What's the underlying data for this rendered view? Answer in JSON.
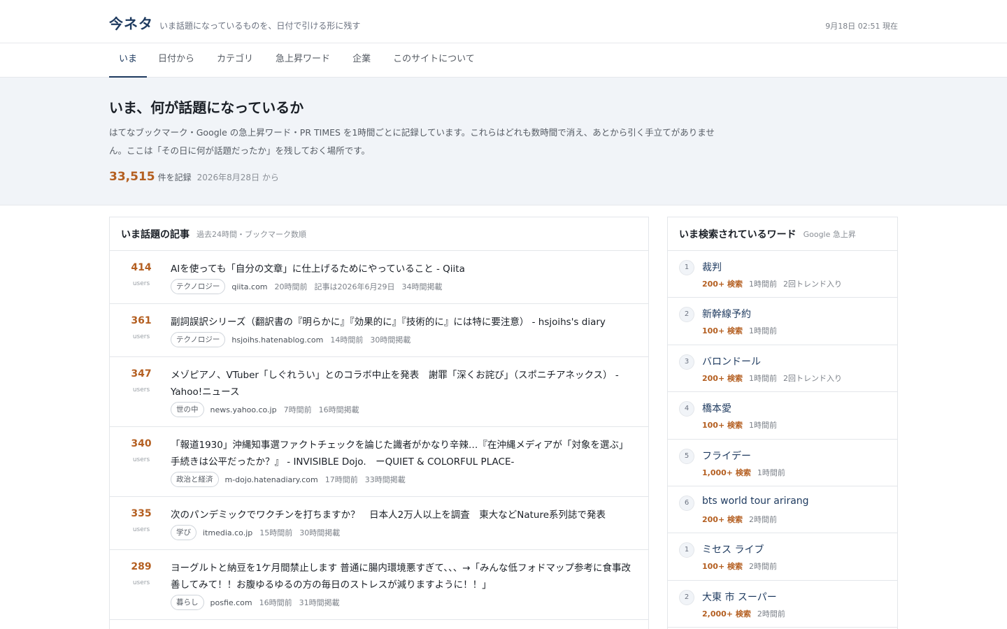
{
  "header": {
    "brand": "今ネタ",
    "tagline": "いま話題になっているものを、日付で引ける形に残す",
    "now": "9月18日 02:51 現在"
  },
  "nav": [
    {
      "label": "いま",
      "active": true
    },
    {
      "label": "日付から",
      "active": false
    },
    {
      "label": "カテゴリ",
      "active": false
    },
    {
      "label": "急上昇ワード",
      "active": false
    },
    {
      "label": "企業",
      "active": false
    },
    {
      "label": "このサイトについて",
      "active": false
    }
  ],
  "hero": {
    "title": "いま、何が話題になっているか",
    "description": "はてなブックマーク・Google の急上昇ワード・PR TIMES を1時間ごとに記録しています。これらはどれも数時間で消え、あとから引く手立てがありません。ここは「その日に何が話題だったか」を残しておく場所です。",
    "count": "33,515",
    "count_label": "件を記録",
    "since": "2026年8月28日 から"
  },
  "articles_panel": {
    "title": "いま話題の記事",
    "subtitle": "過去24時間・ブックマーク数順",
    "unit": "users",
    "items": [
      {
        "score": "414",
        "title": "AIを使っても「自分の文章」に仕上げるためにやっていること - Qiita",
        "tag": "テクノロジー",
        "domain": "qiita.com",
        "ago": "20時間前",
        "posted": "記事は2026年6月29日",
        "listed": "34時間掲載"
      },
      {
        "score": "361",
        "title": "副詞誤訳シリーズ（翻訳書の『明らかに』『効果的に』『技術的に』には特に要注意） - hsjoihs's diary",
        "tag": "テクノロジー",
        "domain": "hsjoihs.hatenablog.com",
        "ago": "14時間前",
        "posted": "",
        "listed": "30時間掲載"
      },
      {
        "score": "347",
        "title": "メゾピアノ、VTuber「しぐれうい」とのコラボ中止を発表　謝罪「深くお詫び」（スポニチアネックス） - Yahoo!ニュース",
        "tag": "世の中",
        "domain": "news.yahoo.co.jp",
        "ago": "7時間前",
        "posted": "",
        "listed": "16時間掲載"
      },
      {
        "score": "340",
        "title": "「報道1930」沖縄知事選ファクトチェックを論じた識者がかなり辛辣…『在沖縄メディアが「対象を選ぶ」手続きは公平だったか？』 - INVISIBLE Dojo.　ーQUIET & COLORFUL PLACE-",
        "tag": "政治と経済",
        "domain": "m-dojo.hatenadiary.com",
        "ago": "17時間前",
        "posted": "",
        "listed": "33時間掲載"
      },
      {
        "score": "335",
        "title": "次のパンデミックでワクチンを打ちますか？　日本人2万人以上を調査　東大などNature系列誌で発表",
        "tag": "学び",
        "domain": "itmedia.co.jp",
        "ago": "15時間前",
        "posted": "",
        "listed": "30時間掲載"
      },
      {
        "score": "289",
        "title": "ヨーグルトと納豆を1ケ月間禁止します 普通に腸内環境悪すぎて、、、→「みんな低フォドマップ参考に食事改善してみて！！お腹ゆるゆるの方の毎日のストレスが減りますように！！」",
        "tag": "暮らし",
        "domain": "posfie.com",
        "ago": "16時間前",
        "posted": "",
        "listed": "31時間掲載"
      }
    ]
  },
  "trends_panel": {
    "title": "いま検索されているワード",
    "subtitle": "Google 急上昇",
    "items": [
      {
        "rank": "1",
        "word": "裁判",
        "volume": "200+ 検索",
        "ago": "1時間前",
        "extra": "2回トレンド入り"
      },
      {
        "rank": "2",
        "word": "新幹線予約",
        "volume": "100+ 検索",
        "ago": "1時間前",
        "extra": ""
      },
      {
        "rank": "3",
        "word": "バロンドール",
        "volume": "200+ 検索",
        "ago": "1時間前",
        "extra": "2回トレンド入り"
      },
      {
        "rank": "4",
        "word": "橋本愛",
        "volume": "100+ 検索",
        "ago": "1時間前",
        "extra": ""
      },
      {
        "rank": "5",
        "word": "フライデー",
        "volume": "1,000+ 検索",
        "ago": "1時間前",
        "extra": ""
      },
      {
        "rank": "6",
        "word": "bts world tour arirang",
        "volume": "200+ 検索",
        "ago": "2時間前",
        "extra": ""
      },
      {
        "rank": "1",
        "word": "ミセス ライブ",
        "volume": "100+ 検索",
        "ago": "2時間前",
        "extra": ""
      },
      {
        "rank": "2",
        "word": "大東 市 スーパー",
        "volume": "2,000+ 検索",
        "ago": "2時間前",
        "extra": ""
      }
    ]
  }
}
